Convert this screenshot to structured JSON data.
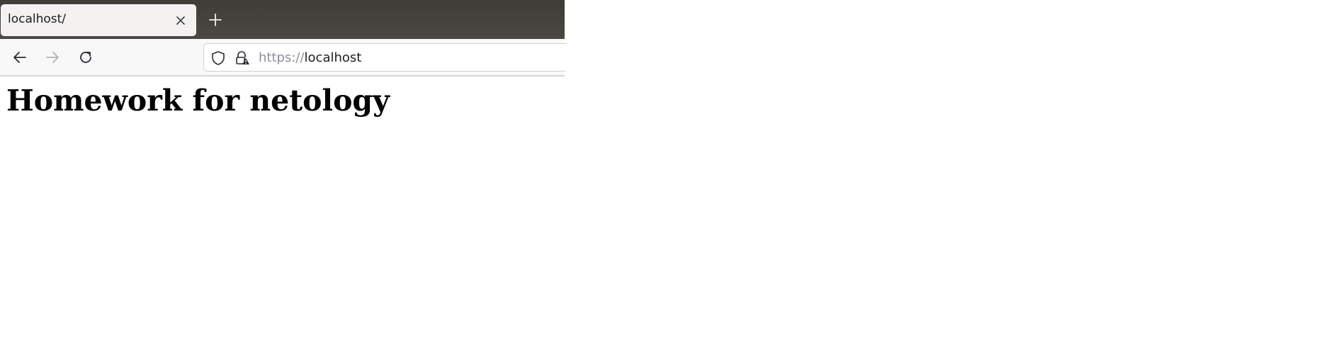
{
  "browser": {
    "tab": {
      "title": "localhost/"
    },
    "icons": {
      "tab_close": "close-icon",
      "new_tab": "plus-icon",
      "back": "back-arrow-icon",
      "forward": "forward-arrow-icon",
      "reload": "reload-icon",
      "tracking_protection": "shield-icon",
      "connection": "lock-warning-icon"
    },
    "url": {
      "scheme": "https://",
      "host": "localhost"
    }
  },
  "page": {
    "heading": "Homework for netology"
  },
  "colors": {
    "tabbar_background": "#3f3d38",
    "tab_background": "#f3f2f1",
    "navbar_background": "#f8f8f8",
    "url_scheme": "#8f8f9d",
    "forward_disabled": "#b0b0b5"
  }
}
